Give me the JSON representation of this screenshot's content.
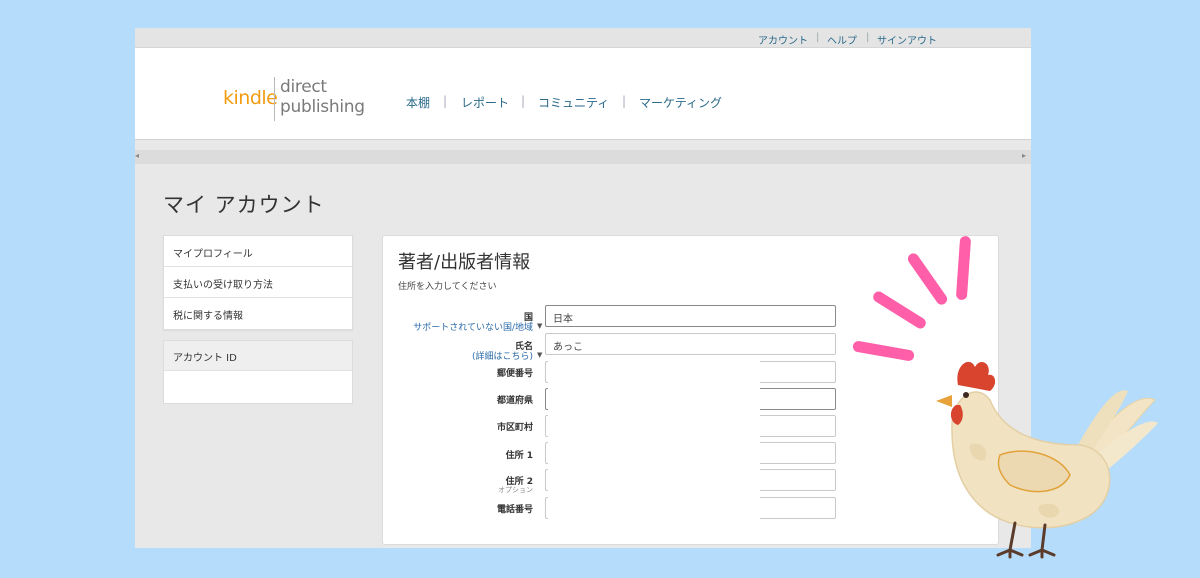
{
  "topbar": {
    "links": [
      "アカウント",
      "ヘルプ",
      "サインアウト"
    ],
    "separator": "|"
  },
  "logo": {
    "kindle": "kindle",
    "line1": "direct",
    "line2": "publishing"
  },
  "nav": {
    "items": [
      "本棚",
      "レポート",
      "コミュニティ",
      "マーケティング"
    ],
    "separator": "|"
  },
  "scroll": {
    "left": "◂",
    "right": "▸"
  },
  "page_title": "マイ アカウント",
  "side_menu": [
    "マイプロフィール",
    "支払いの受け取り方法",
    "税に関する情報"
  ],
  "account_id": {
    "label": "アカウント ID"
  },
  "panel": {
    "title": "著者/出版者情報",
    "subtitle": "住所を入力してください",
    "fields": {
      "country": {
        "label": "国",
        "help": "サポートされていない国/地域",
        "value": "日本"
      },
      "name": {
        "label": "氏名",
        "help": "(詳細はこちら)",
        "value": "あっこ"
      },
      "postal": {
        "label": "郵便番号",
        "value": ""
      },
      "prefecture": {
        "label": "都道府県",
        "value": ""
      },
      "city": {
        "label": "市区町村",
        "value": ""
      },
      "address1": {
        "label": "住所 1",
        "value": ""
      },
      "address2": {
        "label": "住所 2",
        "optional": "オプション",
        "value": ""
      },
      "phone": {
        "label": "電話番号",
        "value": ""
      }
    }
  },
  "colors": {
    "background": "#b5dcfb",
    "kindle_orange": "#f39c12",
    "link_blue": "#2a6a8a",
    "accent_pink": "#ff5ea8"
  }
}
